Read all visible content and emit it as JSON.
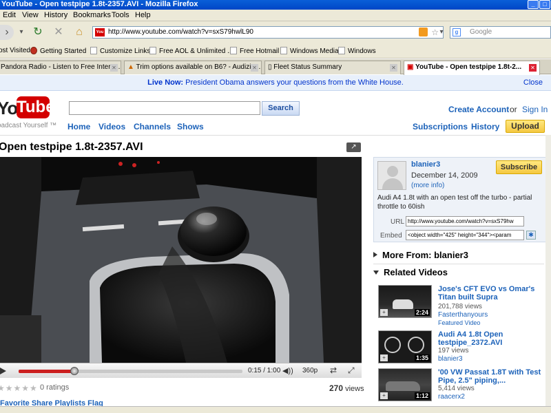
{
  "window": {
    "title": "YouTube - Open testpipe 1.8t-2357.AVI - Mozilla Firefox"
  },
  "menu": [
    "Edit",
    "View",
    "History",
    "Bookmarks",
    "Tools",
    "Help"
  ],
  "nav": {
    "url": "http://www.youtube.com/watch?v=sxS79hwlL90",
    "search_placeholder": "Google"
  },
  "bookmarks": [
    "ost Visited",
    "Getting Started",
    "Customize Links",
    "Free AOL & Unlimited ...",
    "Free Hotmail",
    "Windows Media",
    "Windows"
  ],
  "tabs": [
    {
      "label": "Pandora Radio - Listen to Free Intern..."
    },
    {
      "label": "Trim options available on B6? - Audizin..."
    },
    {
      "label": "Fleet Status Summary"
    },
    {
      "label": "YouTube - Open testpipe 1.8t-2..."
    }
  ],
  "live": {
    "label": "Live Now:",
    "text": "President Obama answers your questions from the White House.",
    "close": "Close"
  },
  "header": {
    "logo_you": "You",
    "logo_tube": "Tube",
    "tagline": "oadcast Yourself ™",
    "search_value": "",
    "search_button": "Search",
    "nav": [
      "Home",
      "Videos",
      "Channels",
      "Shows"
    ],
    "create_account": "Create Account",
    "or": "or",
    "sign_in": "Sign In",
    "subscriptions": "Subscriptions",
    "history": "History",
    "upload": "Upload"
  },
  "video": {
    "title": "Open testpipe 1.8t-2357.AVI",
    "progress": 0.25,
    "time": "0:15 / 1:00",
    "quality": "360p",
    "stars": "★★★★★",
    "ratings": "0 ratings",
    "views_num": "270",
    "views_label": "views",
    "actions": "Favorite   Share   Playlists   Flag"
  },
  "uploader": {
    "name": "blanier3",
    "date": "December 14, 2009",
    "more_info": "(more info)",
    "subscribe": "Subscribe",
    "description": "Audi A4 1.8t with an open test off the turbo - partial throttle to 60ish",
    "url_label": "URL",
    "url_value": "http://www.youtube.com/watch?v=sxS79hw",
    "embed_label": "Embed",
    "embed_value": "<object width=\"425\" height=\"344\"><param"
  },
  "sections": {
    "more_from": "More From: blanier3",
    "related": "Related Videos"
  },
  "related": [
    {
      "title": "Jose's CFT EVO vs Omar's Titan built Supra",
      "views": "201,788 views",
      "author": "Fasterthanyours",
      "featured": "Featured Video",
      "duration": "2:24"
    },
    {
      "title": "Audi A4 1.8t Open testpipe_2372.AVI",
      "views": "197 views",
      "author": "blanier3",
      "featured": "",
      "duration": "1:35"
    },
    {
      "title": "'00 VW Passat 1.8T with Test Pipe, 2.5\" piping,...",
      "views": "5,414 views",
      "author": "raacerx2",
      "featured": "",
      "duration": "1:12"
    }
  ],
  "colors": {
    "youtube_red": "#d40000",
    "link_blue": "#1c62b9",
    "progress_red": "#cc1f1f"
  }
}
